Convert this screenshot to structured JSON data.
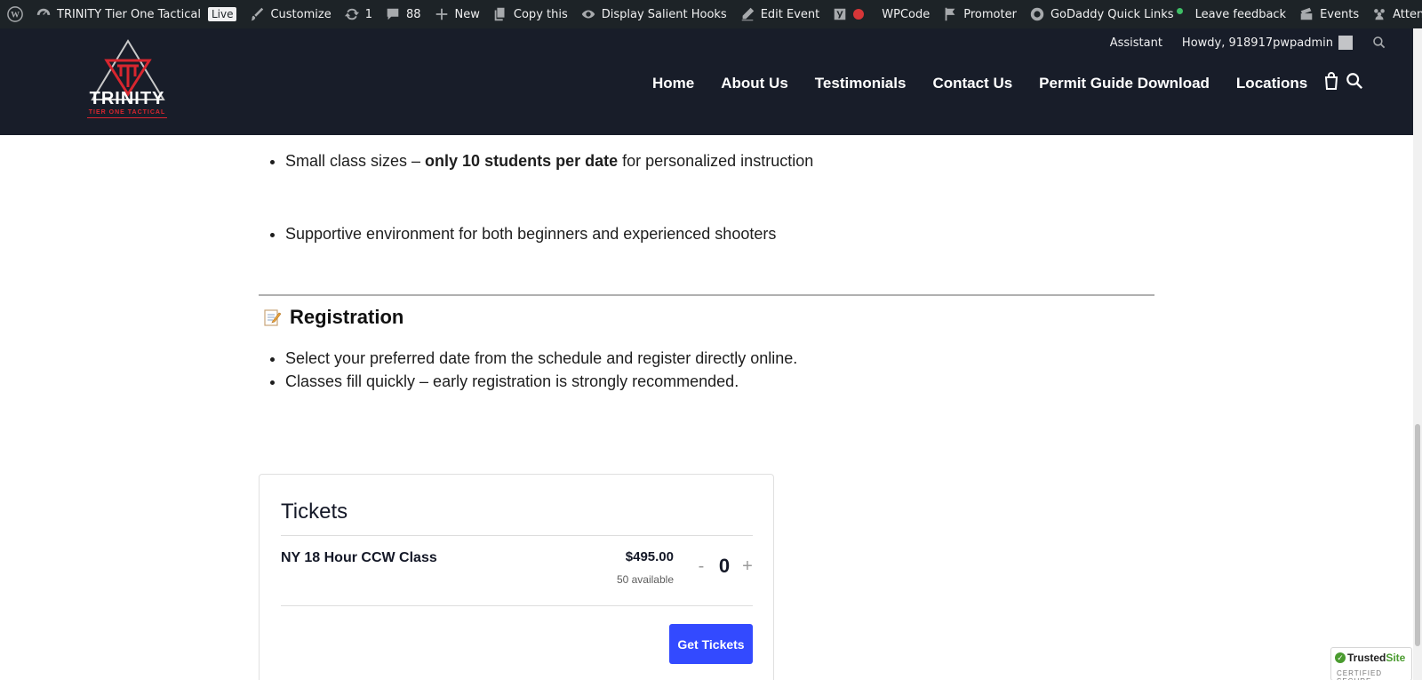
{
  "admin_bar": {
    "site_name": "TRINITY Tier One Tactical",
    "live_badge": "Live",
    "customize": "Customize",
    "updates_count": "1",
    "comments_count": "88",
    "new": "New",
    "copy_this": "Copy this",
    "display_salient_hooks": "Display Salient Hooks",
    "edit_event": "Edit Event",
    "wpcode": "WPCode",
    "promoter": "Promoter",
    "godaddy_quick_links": "GoDaddy Quick Links",
    "leave_feedback": "Leave feedback",
    "events": "Events",
    "attendees": "Attendees",
    "assistant": "Assistant",
    "howdy": "Howdy, 918917pwpadmin"
  },
  "header": {
    "logo_title": "TRINITY",
    "logo_subtitle": "TIER ONE TACTICAL",
    "nav": [
      "Home",
      "About Us",
      "Testimonials",
      "Contact Us",
      "Permit Guide Download",
      "Locations"
    ]
  },
  "content": {
    "bullet_class_size_prefix": "Small class sizes – ",
    "bullet_class_size_bold": "only 10 students per date",
    "bullet_class_size_suffix": " for personalized instruction",
    "bullet_environment": "Supportive environment for both beginners and experienced shooters",
    "registration_heading": "Registration",
    "registration_bullets": [
      "Select your preferred date from the schedule and register directly online.",
      "Classes fill quickly – early registration is strongly recommended."
    ]
  },
  "tickets": {
    "heading": "Tickets",
    "name": "NY 18 Hour CCW Class",
    "price": "$495.00",
    "available": "50 available",
    "quantity": "0",
    "minus": "-",
    "plus": "+",
    "button": "Get Tickets"
  },
  "trusted_site": {
    "brand_a": "Trusted",
    "brand_b": "Site",
    "sub": "CERTIFIED SECURE"
  },
  "colors": {
    "admin_bar": "#1d2327",
    "header": "#181d29",
    "accent_red": "#d8262f",
    "button_blue": "#334aff"
  }
}
